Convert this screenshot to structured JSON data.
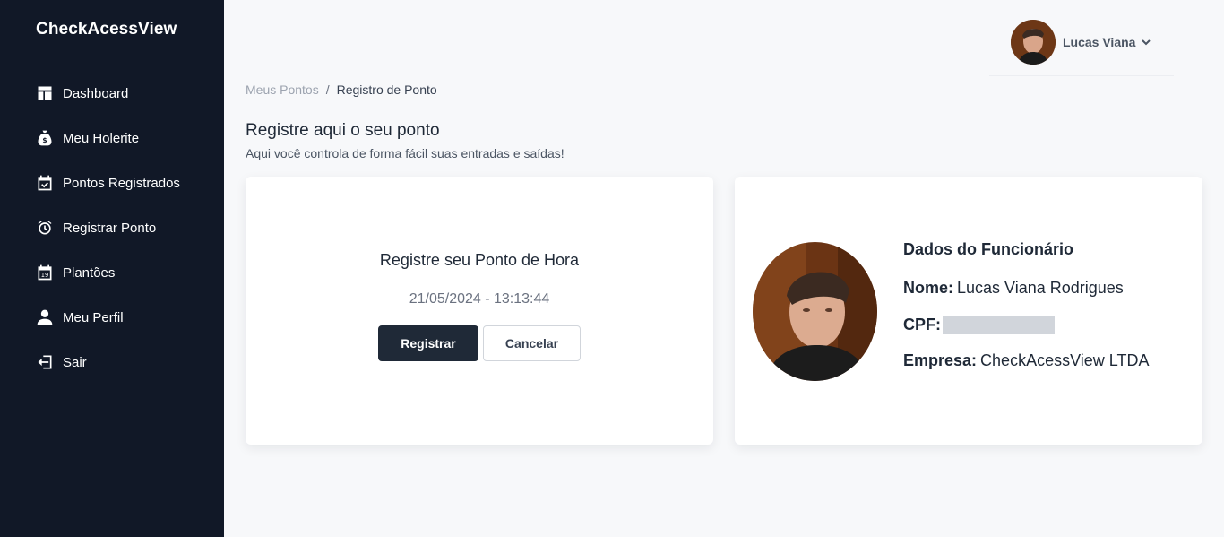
{
  "sidebar": {
    "brand": "CheckAcessView",
    "items": [
      {
        "label": "Dashboard",
        "icon": "dashboard-icon"
      },
      {
        "label": "Meu Holerite",
        "icon": "money-bag-icon"
      },
      {
        "label": "Pontos Registrados",
        "icon": "calendar-check-icon"
      },
      {
        "label": "Registrar Ponto",
        "icon": "alarm-clock-icon"
      },
      {
        "label": "Plantões",
        "icon": "calendar-day-icon"
      },
      {
        "label": "Meu Perfil",
        "icon": "user-icon"
      },
      {
        "label": "Sair",
        "icon": "logout-icon"
      }
    ]
  },
  "header": {
    "user_name": "Lucas Viana"
  },
  "breadcrumb": {
    "parent": "Meus Pontos",
    "separator": "/",
    "current": "Registro de Ponto"
  },
  "page": {
    "title": "Registre aqui o seu ponto",
    "subtitle": "Aqui você controla de forma fácil suas entradas e saídas!"
  },
  "punch_card": {
    "title": "Registre seu Ponto de Hora",
    "datetime": "21/05/2024 - 13:13:44",
    "register_label": "Registrar",
    "cancel_label": "Cancelar"
  },
  "employee_card": {
    "title": "Dados do Funcionário",
    "name_label": "Nome:",
    "name_value": "Lucas Viana Rodrigues",
    "cpf_label": "CPF:",
    "company_label": "Empresa:",
    "company_value": "CheckAcessView LTDA"
  },
  "colors": {
    "sidebar_bg": "#111827",
    "page_bg": "#f7f8fa",
    "primary_button": "#1f2937"
  }
}
